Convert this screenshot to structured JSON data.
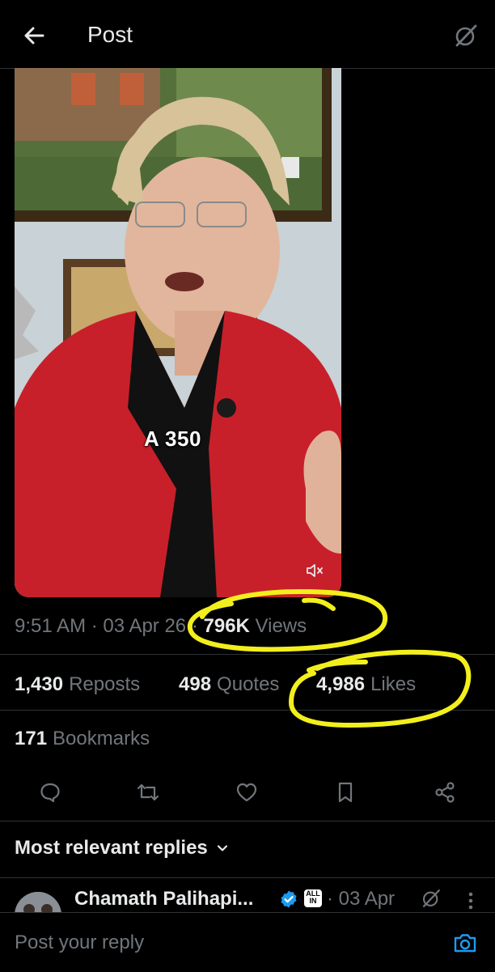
{
  "header": {
    "title": "Post",
    "back_icon": "arrow-left-icon",
    "grok_icon": "grok-icon"
  },
  "media": {
    "caption": "A 350",
    "mute_icon": "volume-mute-icon"
  },
  "meta": {
    "time": "9:51 AM",
    "date": "03 Apr 26",
    "views_count": "796K",
    "views_label": "Views"
  },
  "stats": {
    "reposts_count": "1,430",
    "reposts_label": "Reposts",
    "quotes_count": "498",
    "quotes_label": "Quotes",
    "likes_count": "4,986",
    "likes_label": "Likes",
    "bookmarks_count": "171",
    "bookmarks_label": "Bookmarks"
  },
  "actions": [
    "reply-icon",
    "repost-icon",
    "like-icon",
    "bookmark-icon",
    "share-icon"
  ],
  "replies": {
    "sort_label": "Most relevant replies",
    "items": [
      {
        "author": "Chamath Palihapi...",
        "badge": "ALL IN",
        "date": "· 03 Apr"
      }
    ]
  },
  "composer": {
    "placeholder": "Post your reply"
  },
  "colors": {
    "background": "#000000",
    "text": "#e7e9ea",
    "muted": "#71767b",
    "accent": "#1d9bf0",
    "highlight": "#f3ef1c"
  }
}
